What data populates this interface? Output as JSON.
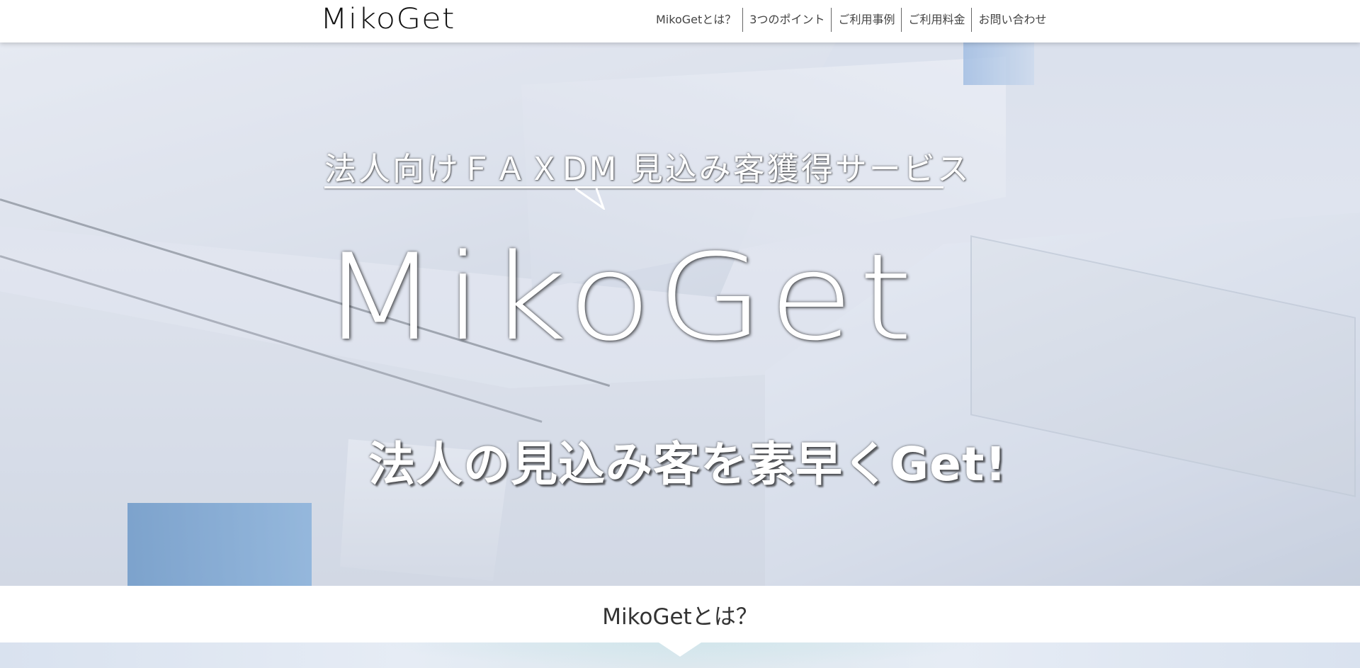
{
  "header": {
    "logo": "MikoGet",
    "nav": [
      {
        "label": "MikoGetとは？"
      },
      {
        "label": "3つのポイント"
      },
      {
        "label": "ご利用事例"
      },
      {
        "label": "ご利用料金"
      },
      {
        "label": "お問い合わせ"
      }
    ]
  },
  "hero": {
    "tagline": "法人向けＦＡＸDM 見込み客獲得サービス",
    "logo": "MikoGet",
    "catchphrase": "法人の見込み客を素早くGet!"
  },
  "section": {
    "title": "MikoGetとは？"
  },
  "colors": {
    "text_dark": "#333333",
    "hero_text": "#ffffff",
    "hero_bg": "#dde3ee"
  }
}
